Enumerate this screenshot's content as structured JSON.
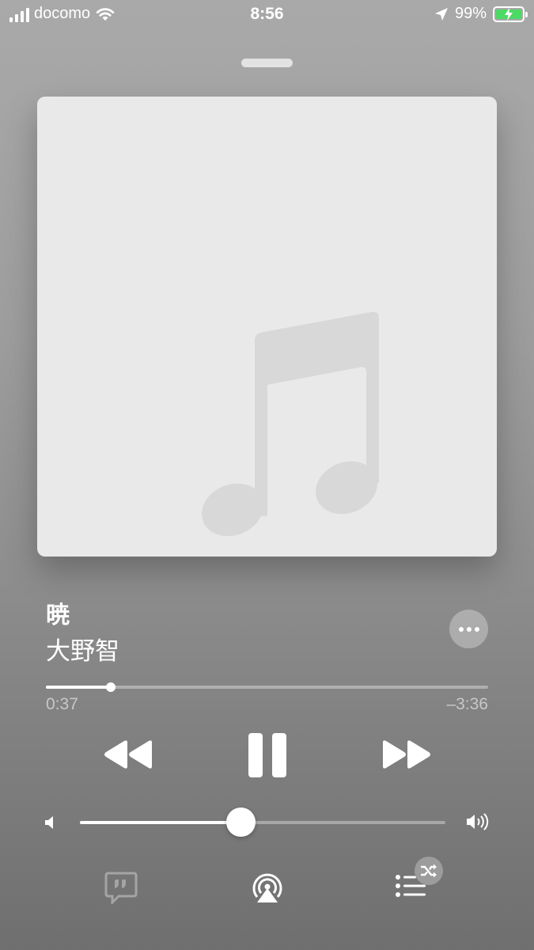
{
  "status_bar": {
    "carrier": "docomo",
    "time": "8:56",
    "battery_percent": "99%",
    "battery_level": 0.99,
    "icons": [
      "signal-bars-icon",
      "wifi-icon",
      "location-arrow-icon",
      "battery-charging-icon"
    ],
    "battery_color": "#4cd964"
  },
  "now_playing": {
    "artwork_icon": "music-note-icon",
    "title": "暁",
    "artist": "大野智",
    "more_icon": "ellipsis-icon"
  },
  "progress": {
    "elapsed": "0:37",
    "remaining": "–3:36",
    "fraction": 0.146
  },
  "controls": {
    "rewind_icon": "rewind-icon",
    "pause_icon": "pause-icon",
    "forward_icon": "fast-forward-icon"
  },
  "volume": {
    "level": 0.44,
    "low_icon": "speaker-low-icon",
    "high_icon": "speaker-high-icon"
  },
  "bottom_bar": {
    "icons": [
      "lyrics-icon",
      "airplay-icon",
      "queue-icon",
      "shuffle-icon"
    ]
  }
}
